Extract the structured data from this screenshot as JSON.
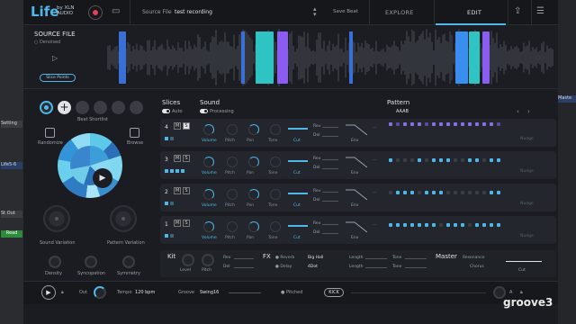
{
  "host": {
    "items": [
      "Setting",
      "Life5-6",
      "St Out",
      "Read",
      "Maste"
    ]
  },
  "topbar": {
    "logo": "Life",
    "logo_sub1": "by XLN",
    "logo_sub2": "AUDIO",
    "source_label": "Source File",
    "source_value": "test recording",
    "save_beat": "Save Beat",
    "tab_explore": "EXPLORE",
    "tab_edit": "EDIT"
  },
  "source": {
    "title": "SOURCE FILE",
    "denoised": "Denoised",
    "slice_points": "Slice Points"
  },
  "left": {
    "beat_shortlist": "Beat Shortlist",
    "randomize": "Randomize",
    "browse": "Browse",
    "sound_variation": "Sound Variation",
    "pattern_variation": "Pattern Variation",
    "density": "Density",
    "syncopation": "Syncopation",
    "symmetry": "Symmetry"
  },
  "tracks": {
    "slices": "Slices",
    "auto": "Auto",
    "sound": "Sound",
    "processing": "Processing",
    "pattern": "Pattern",
    "pattern_name": "AAAB",
    "knobs": [
      "Volume",
      "Pitch",
      "Pan",
      "Tone",
      "Cut"
    ],
    "rev": "Rev",
    "del": "Del",
    "env": "Env",
    "nudge": "Nudge",
    "rows": [
      "4",
      "3",
      "2",
      "1"
    ],
    "m": "M",
    "s": "S"
  },
  "kitfx": {
    "kit": "Kit",
    "level": "Level",
    "pitch": "Pitch",
    "rev": "Rev",
    "del": "Del",
    "fx": "FX",
    "reverb": "Reverb",
    "reverb_val": "Big Hall",
    "delay": "Delay",
    "delay_val": "4Dot",
    "length": "Length",
    "tone": "Tone",
    "master": "Master",
    "resonance": "Resonance",
    "chorus": "Chorus",
    "cut": "Cut"
  },
  "bottom": {
    "out": "Out",
    "tempo": "Tempo",
    "tempo_val": "120 bpm",
    "groove": "Groove",
    "groove_val": "Swing16",
    "pitched": "Pitched",
    "kick": "KICK"
  },
  "watermark": "groove3"
}
